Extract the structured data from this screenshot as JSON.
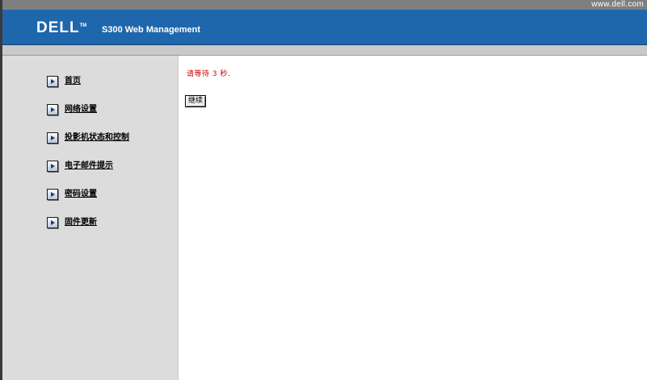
{
  "header": {
    "top_link": "www.dell.com",
    "logo": "DELL",
    "logo_tm": "TM",
    "title": "S300 Web Management"
  },
  "sidebar": {
    "items": [
      {
        "label": "首页"
      },
      {
        "label": "网络设置"
      },
      {
        "label": "投影机状态和控制"
      },
      {
        "label": "电子邮件提示"
      },
      {
        "label": "密码设置"
      },
      {
        "label": "固件更新"
      }
    ]
  },
  "main": {
    "wait_message": "请等待 3 秒.",
    "continue_label": "继续"
  },
  "colors": {
    "header_blue": "#1e67ac",
    "top_strip_gray": "#7f7f7f",
    "sidebar_bg": "#dcdcdc",
    "message_red": "#cc0000"
  }
}
